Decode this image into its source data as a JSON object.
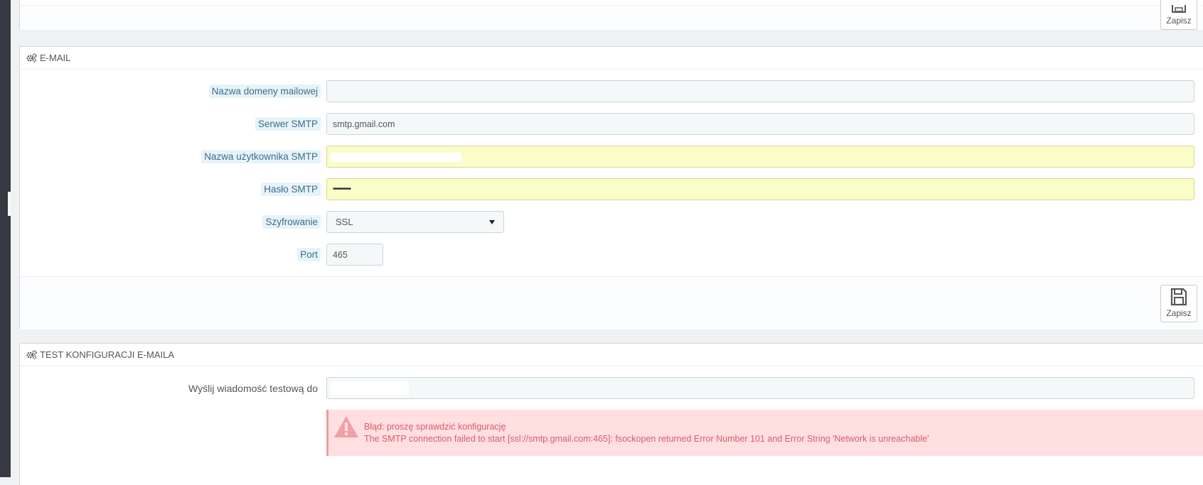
{
  "top_panel": {
    "save_label": "Zapisz"
  },
  "email_panel": {
    "title": "E-MAIL",
    "fields": {
      "domain": {
        "label": "Nazwa domeny mailowej",
        "value": ""
      },
      "smtp_server": {
        "label": "Serwer SMTP",
        "value": "smtp.gmail.com"
      },
      "smtp_user": {
        "label": "Nazwa użytkownika SMTP",
        "value": ""
      },
      "smtp_password": {
        "label": "Hasło SMTP",
        "value": "••••••••••"
      },
      "encryption": {
        "label": "Szyfrowanie",
        "value": "SSL"
      },
      "port": {
        "label": "Port",
        "value": "465"
      }
    },
    "save_label": "Zapisz"
  },
  "test_panel": {
    "title": "TEST KONFIGURACJI E-MAILA",
    "send_to": {
      "label": "Wyślij wiadomość testową do",
      "value": ""
    },
    "alert": {
      "line1": "Błąd: proszę sprawdzić konfigurację",
      "line2": "The SMTP connection failed to start [ssl://smtp.gmail.com:465]: fsockopen returned Error Number 101 and Error String 'Network is unreachable'"
    }
  },
  "icons": {
    "heading": "cogs-icon",
    "save": "floppy-disk-icon",
    "alert": "warning-triangle-icon",
    "select": "caret-down-icon"
  },
  "colors": {
    "label_bg": "#e8f3f8",
    "label_text": "#3a6f8f",
    "autofill_bg": "#fbfdc8",
    "alert_bg": "#ffdfe0",
    "alert_text": "#d95c6a"
  }
}
